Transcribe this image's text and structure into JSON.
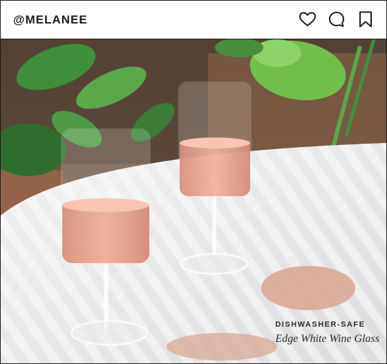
{
  "post": {
    "handle": "@MELANEE",
    "caption_tag": "DISHWASHER-SAFE",
    "caption_product": "Edge White Wine Glass"
  },
  "icons": {
    "like": "heart-icon",
    "comment": "chat-bubble-icon",
    "save": "bookmark-icon"
  },
  "colors": {
    "wine": "#e8a08c",
    "table": "#e9e9ea"
  }
}
